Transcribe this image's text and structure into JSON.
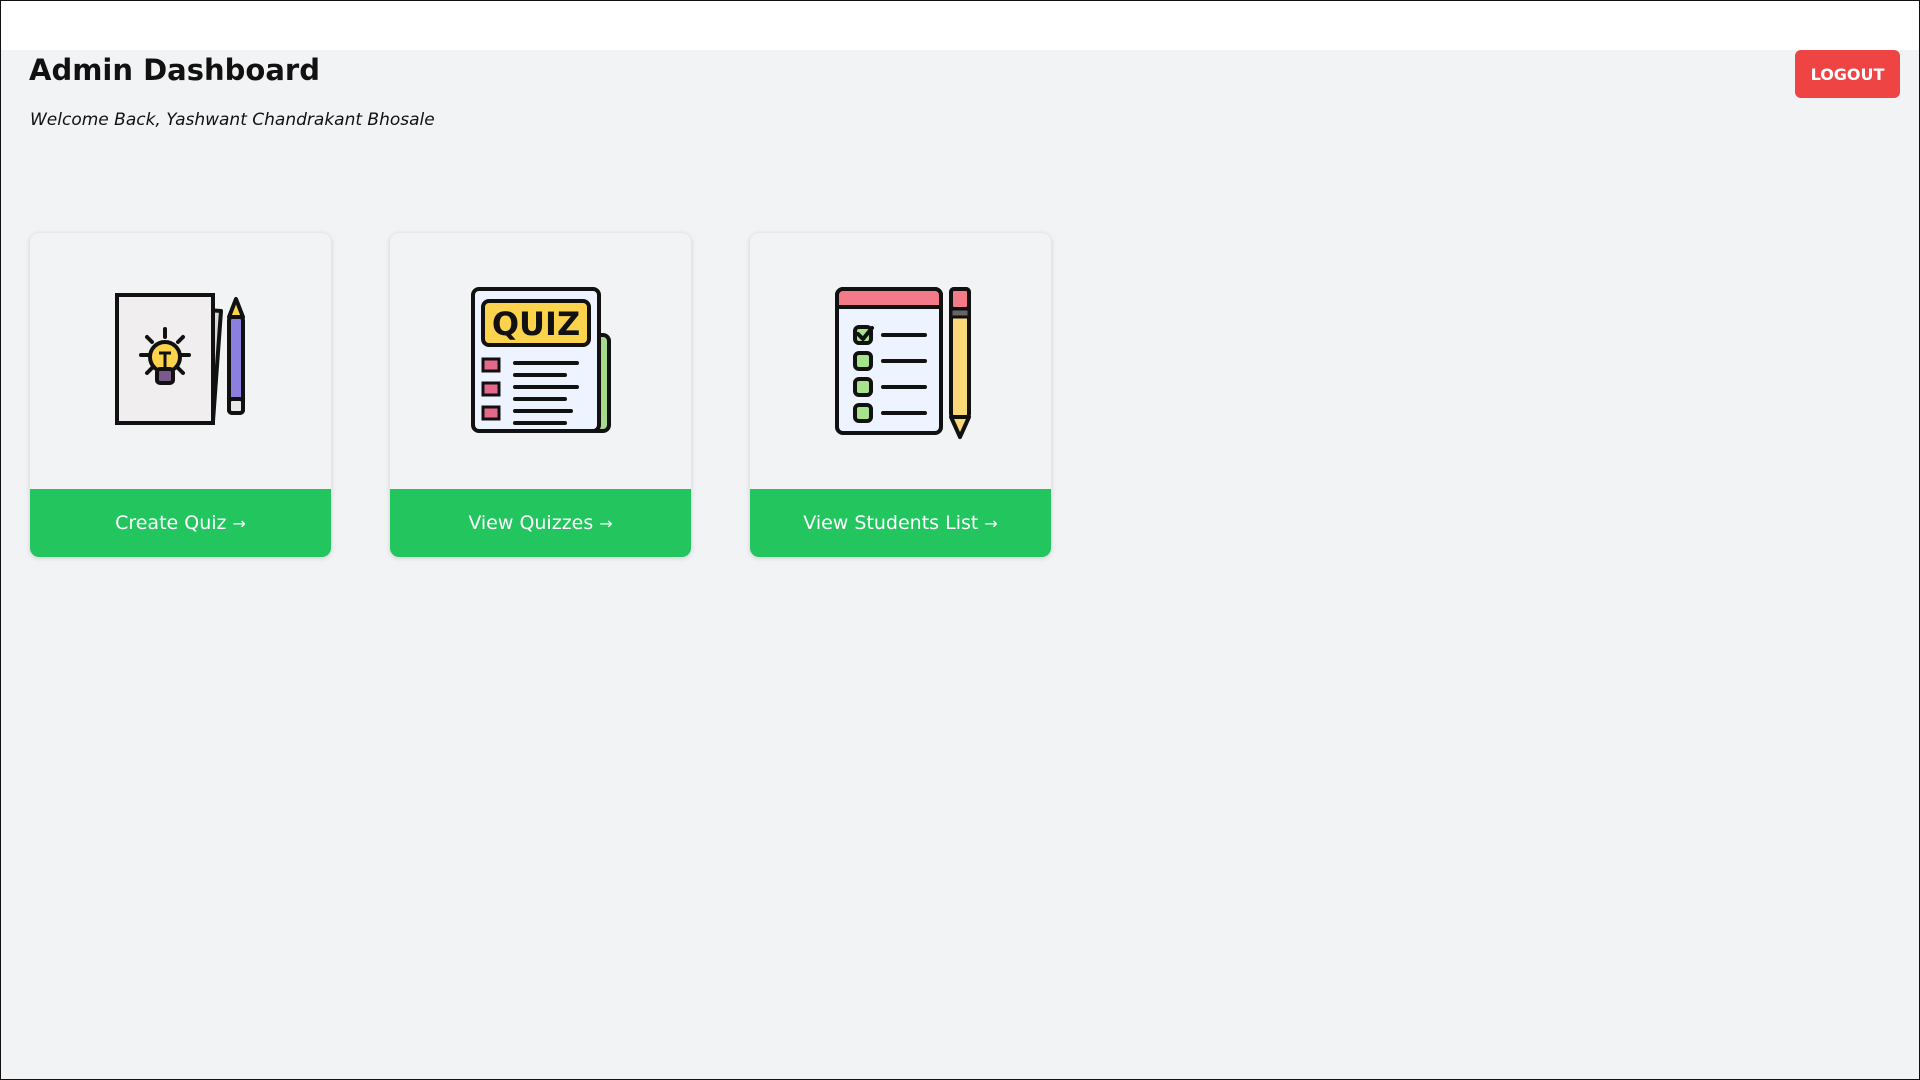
{
  "header": {
    "title": "Admin Dashboard",
    "welcome": "Welcome Back, Yashwant Chandrakant Bhosale",
    "logout_label": "LOGOUT"
  },
  "cards": [
    {
      "label": "Create Quiz",
      "icon": "quiz-idea-icon"
    },
    {
      "label": "View Quizzes",
      "icon": "quiz-paper-icon"
    },
    {
      "label": "View Students List",
      "icon": "checklist-icon"
    }
  ],
  "arrow_glyph": "→",
  "colors": {
    "background": "#f2f3f5",
    "cta": "#22c55e",
    "logout": "#ef4444"
  }
}
